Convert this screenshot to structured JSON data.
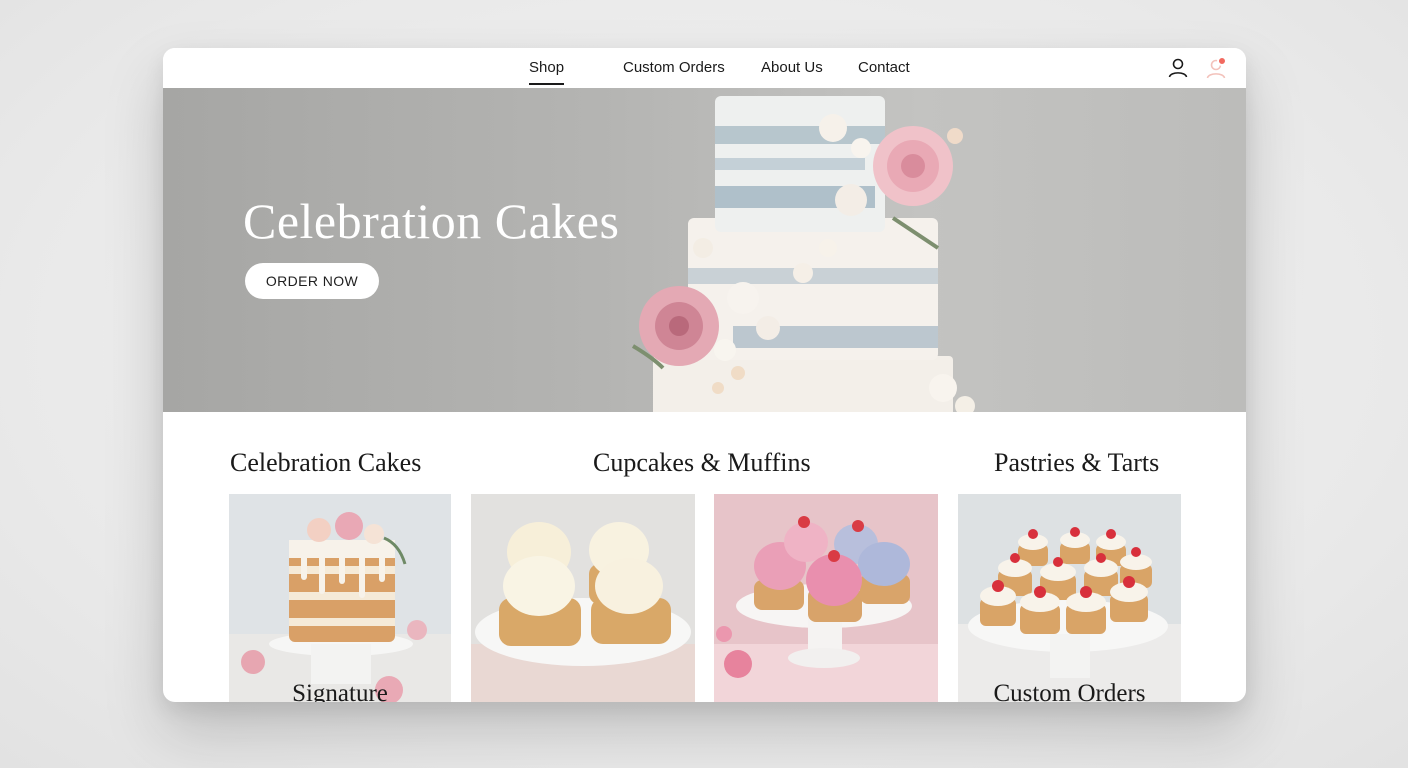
{
  "nav": {
    "items": [
      {
        "label": "Shop",
        "active": true
      },
      {
        "label": "Custom Orders",
        "active": false
      },
      {
        "label": "About Us",
        "active": false
      },
      {
        "label": "Contact",
        "active": false
      }
    ],
    "icons": [
      "user-icon",
      "cart-icon"
    ],
    "accent_color": "#f2695f"
  },
  "hero": {
    "title": "Celebration Cakes",
    "cta_label": "ORDER NOW"
  },
  "categories": [
    {
      "title": "Celebration Cakes"
    },
    {
      "title": "Cupcakes & Muffins"
    },
    {
      "title": "Pastries & Tarts"
    }
  ],
  "cards": [
    {
      "label": "Signature"
    },
    {
      "label": ""
    },
    {
      "label": ""
    },
    {
      "label": "Custom Orders"
    }
  ]
}
